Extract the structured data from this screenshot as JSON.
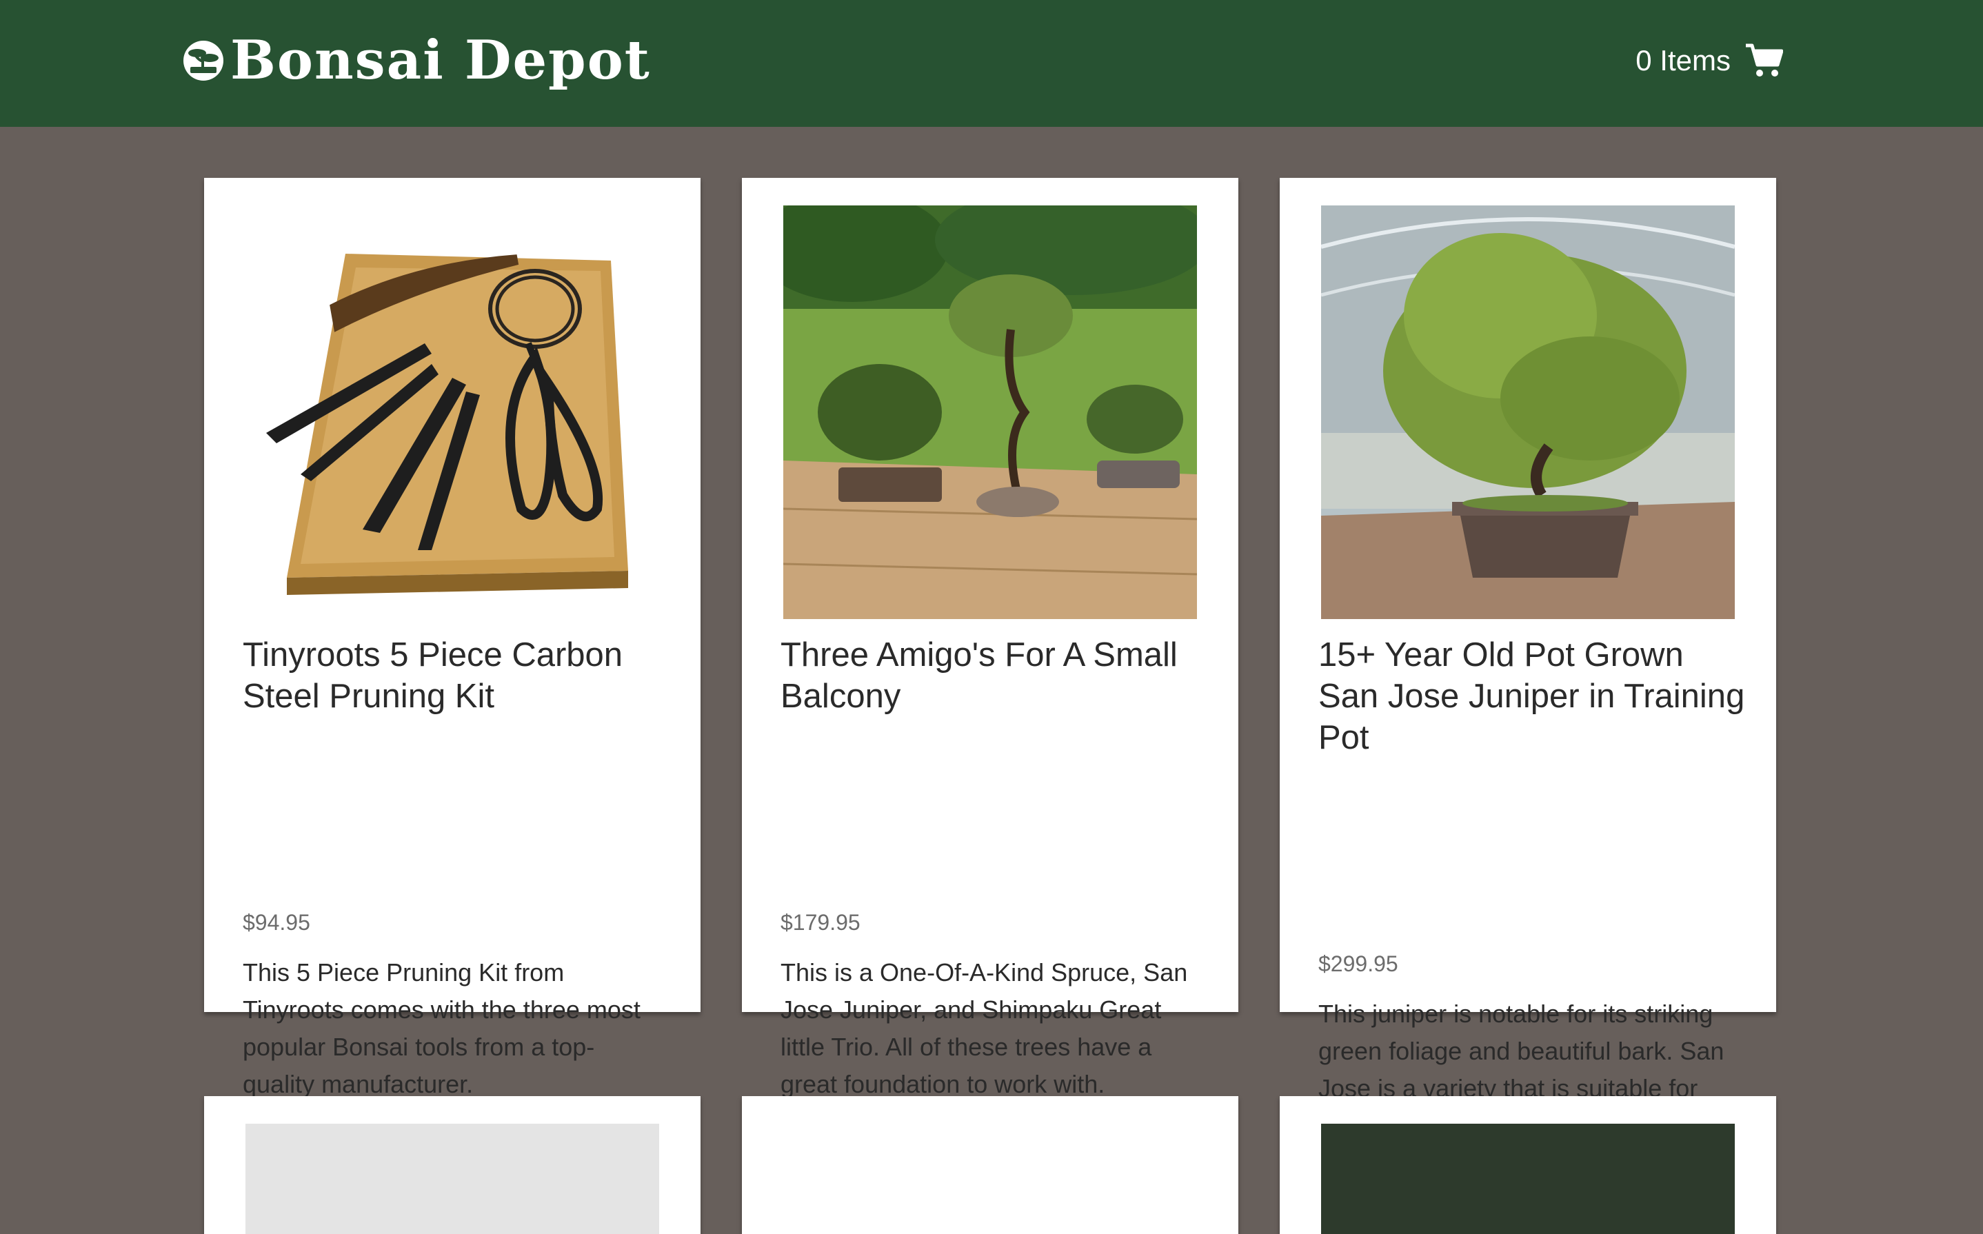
{
  "header": {
    "brand": "Bonsai Depot",
    "cart_label": "0 Items",
    "logo_icon": "bonsai-logo-icon",
    "cart_icon": "shopping-cart-icon"
  },
  "colors": {
    "header_bg": "#275232",
    "page_bg": "#675f5b",
    "card_bg": "#ffffff"
  },
  "products": [
    {
      "title": "Tinyroots 5 Piece Carbon Steel Pruning Kit",
      "price": "$94.95",
      "description": "This 5 Piece Pruning Kit from Tinyroots comes with the three most popular Bonsai tools from a top-quality manufacturer.",
      "image": "pruning-kit-photo"
    },
    {
      "title": "Three Amigo's For A Small Balcony",
      "price": "$179.95",
      "description": "This is a One-Of-A-Kind Spruce, San Jose Juniper, and Shimpaku Great little Trio. All of these trees have a great foundation to work with.",
      "image": "three-bonsai-photo"
    },
    {
      "title": "15+ Year Old Pot Grown San Jose Juniper in Training Pot",
      "price": "$299.95",
      "description": "This juniper is notable for its striking green foliage and beautiful bark. San Jose is a variety that is suitable for upright, cascade, semi-cascade styles.",
      "image": "juniper-bonsai-photo"
    }
  ]
}
